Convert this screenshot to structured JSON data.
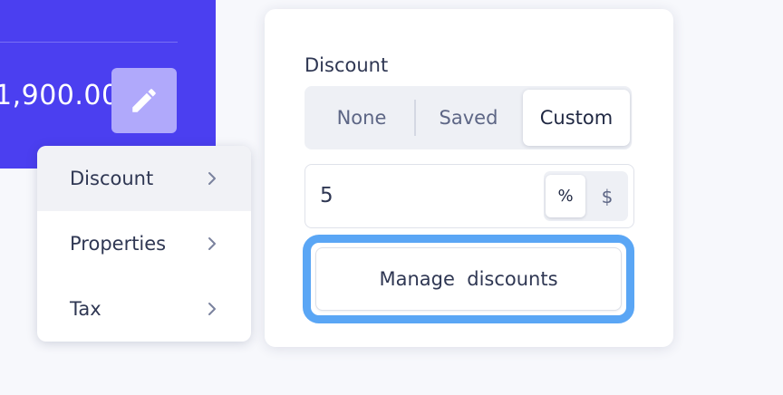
{
  "colors": {
    "brand_blue": "#4b3ff0",
    "edit_button": "#b0a9fb",
    "focus_ring": "#5aa6f5",
    "text": "#2f3753",
    "muted_text": "#5d6685"
  },
  "summary": {
    "amount": "1,900.00",
    "edit_icon": "pencil-icon"
  },
  "menu": {
    "items": [
      {
        "label": "Discount",
        "icon": "chevron-right-icon",
        "active": true
      },
      {
        "label": "Properties",
        "icon": "chevron-right-icon",
        "active": false
      },
      {
        "label": "Tax",
        "icon": "chevron-right-icon",
        "active": false
      }
    ]
  },
  "discount": {
    "title": "Discount",
    "modes": [
      "None",
      "Saved",
      "Custom"
    ],
    "selected_mode": "Custom",
    "value": "5",
    "units": [
      "%",
      "$"
    ],
    "selected_unit": "%",
    "manage_label": "Manage  discounts"
  }
}
